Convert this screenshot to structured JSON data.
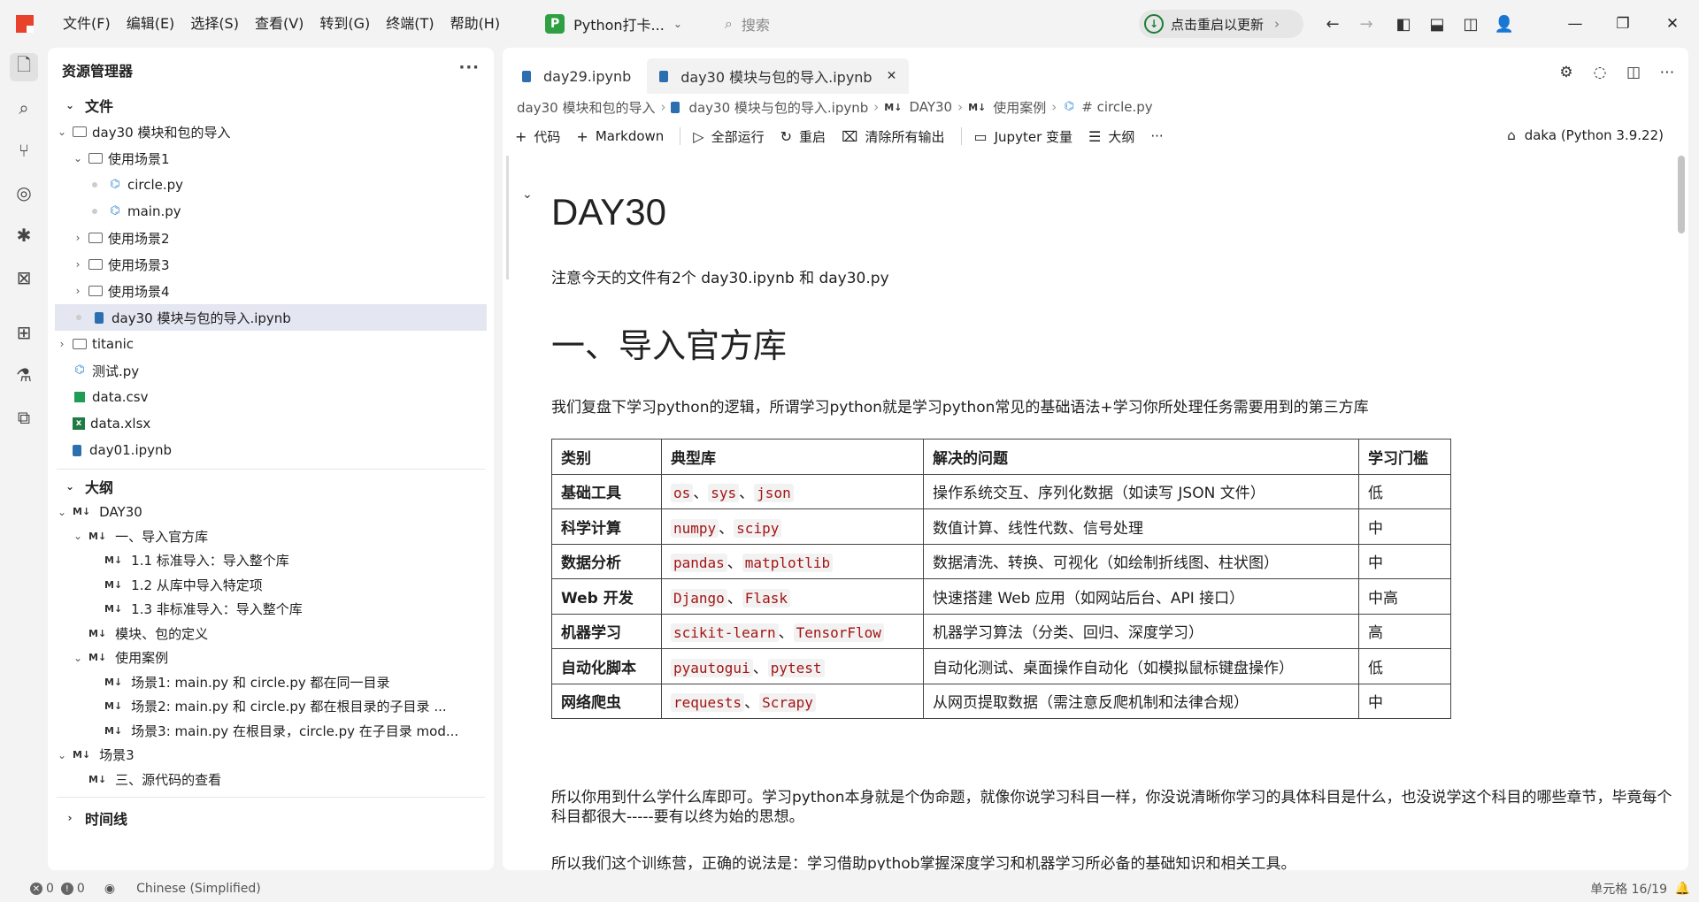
{
  "menu": [
    "文件(F)",
    "编辑(E)",
    "选择(S)",
    "查看(V)",
    "转到(G)",
    "终端(T)",
    "帮助(H)"
  ],
  "profile": {
    "badge": "P",
    "name": "Python打卡..."
  },
  "search": {
    "placeholder": "搜索"
  },
  "update": {
    "label": "点击重启以更新"
  },
  "sidebar": {
    "title": "资源管理器",
    "files_section": "文件",
    "tree": [
      {
        "label": "day30 模块和包的导入"
      },
      {
        "label": "使用场景1"
      },
      {
        "label": "circle.py"
      },
      {
        "label": "main.py"
      },
      {
        "label": "使用场景2"
      },
      {
        "label": "使用场景3"
      },
      {
        "label": "使用场景4"
      },
      {
        "label": "day30 模块与包的导入.ipynb"
      },
      {
        "label": "titanic"
      },
      {
        "label": "测试.py"
      },
      {
        "label": "data.csv"
      },
      {
        "label": "data.xlsx"
      },
      {
        "label": "day01.ipynb"
      }
    ],
    "outline_section": "大纲",
    "md_badge": "M↓",
    "outline": [
      {
        "label": "DAY30"
      },
      {
        "label": "一、导入官方库"
      },
      {
        "label": "1.1 标准导入：导入整个库"
      },
      {
        "label": "1.2 从库中导入特定项"
      },
      {
        "label": "1.3 非标准导入：导入整个库"
      },
      {
        "label": "模块、包的定义"
      },
      {
        "label": "使用案例"
      },
      {
        "label": "场景1: main.py 和 circle.py 都在同一目录"
      },
      {
        "label": "场景2: main.py 和 circle.py 都在根目录的子目录 ..."
      },
      {
        "label": "场景3: main.py 在根目录，circle.py 在子目录 mod..."
      },
      {
        "label": "场景3"
      },
      {
        "label": "三、源代码的查看"
      }
    ],
    "timeline_section": "时间线"
  },
  "tabs": [
    {
      "label": "day29.ipynb"
    },
    {
      "label": "day30 模块与包的导入.ipynb"
    }
  ],
  "breadcrumb": [
    "day30 模块和包的导入",
    "day30 模块与包的导入.ipynb",
    "DAY30",
    "使用案例",
    "# circle.py"
  ],
  "toolbar": {
    "code": "代码",
    "markdown": "Markdown",
    "run_all": "全部运行",
    "restart": "重启",
    "clear": "清除所有输出",
    "variables": "Jupyter 变量",
    "outline": "大纲",
    "more": "···",
    "kernel": "daka (Python 3.9.22)"
  },
  "doc": {
    "h1": "DAY30",
    "p1": "注意今天的文件有2个 day30.ipynb 和 day30.py",
    "h2": "一、导入官方库",
    "p2": "我们复盘下学习python的逻辑，所谓学习python就是学习python常见的基础语法+学习你所处理任务需要用到的第三方库",
    "table_headers": [
      "类别",
      "典型库",
      "解决的问题",
      "学习门槛"
    ],
    "table_rows": [
      {
        "cat": "基础工具",
        "libs": [
          "os",
          "sys",
          "json"
        ],
        "problem": "操作系统交互、序列化数据（如读写 JSON 文件）",
        "level": "低"
      },
      {
        "cat": "科学计算",
        "libs": [
          "numpy",
          "scipy"
        ],
        "problem": "数值计算、线性代数、信号处理",
        "level": "中"
      },
      {
        "cat": "数据分析",
        "libs": [
          "pandas",
          "matplotlib"
        ],
        "problem": "数据清洗、转换、可视化（如绘制折线图、柱状图）",
        "level": "中"
      },
      {
        "cat": "Web 开发",
        "libs": [
          "Django",
          "Flask"
        ],
        "problem": "快速搭建 Web 应用（如网站后台、API 接口）",
        "level": "中高"
      },
      {
        "cat": "机器学习",
        "libs": [
          "scikit-learn",
          "TensorFlow"
        ],
        "problem": "机器学习算法（分类、回归、深度学习）",
        "level": "高"
      },
      {
        "cat": "自动化脚本",
        "libs": [
          "pyautogui",
          "pytest"
        ],
        "problem": "自动化测试、桌面操作自动化（如模拟鼠标键盘操作）",
        "level": "低"
      },
      {
        "cat": "网络爬虫",
        "libs": [
          "requests",
          "Scrapy"
        ],
        "problem": "从网页提取数据（需注意反爬机制和法律合规）",
        "level": "中"
      }
    ],
    "p3": "所以你用到什么学什么库即可。学习python本身就是个伪命题，就像你说学习科目一样，你没说清晰你学习的具体科目是什么，也没说学这个科目的哪些章节，毕竟每个科目都很大-----要有以终为始的思想。",
    "p4": "所以我们这个训练营，正确的说法是：学习借助pythob掌握深度学习和机器学习所必备的基础知识和相关工具。"
  },
  "status": {
    "errors": "0",
    "warnings": "0",
    "language": "Chinese (Simplified)",
    "cell": "单元格 16/19"
  }
}
